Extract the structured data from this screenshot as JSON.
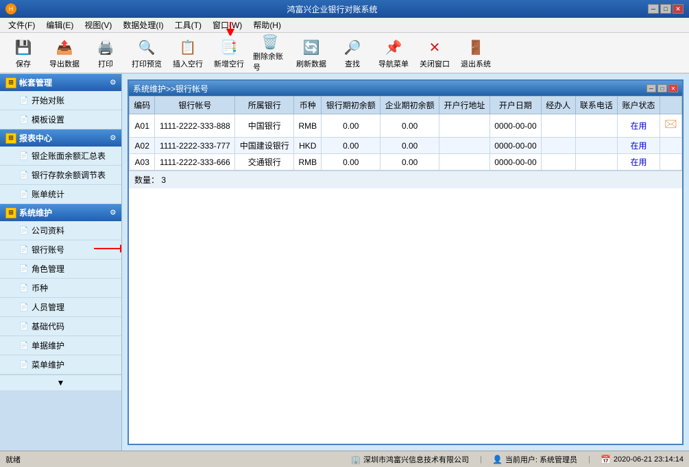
{
  "app": {
    "title": "鸿富兴企业银行对账系统",
    "status_text": "就绪",
    "company": "深圳市鸿富兴信息技术有限公司",
    "current_user": "当前用户: 系统管理员",
    "datetime": "2020-06-21 23:14:14"
  },
  "menu": {
    "items": [
      {
        "label": "文件(F)"
      },
      {
        "label": "编辑(E)"
      },
      {
        "label": "视图(V)"
      },
      {
        "label": "数据处理(I)"
      },
      {
        "label": "工具(T)"
      },
      {
        "label": "窗口(W)"
      },
      {
        "label": "帮助(H)"
      }
    ]
  },
  "toolbar": {
    "buttons": [
      {
        "id": "save",
        "label": "保存",
        "icon": "💾"
      },
      {
        "id": "export",
        "label": "导出数据",
        "icon": "📤"
      },
      {
        "id": "print",
        "label": "打印",
        "icon": "🖨️"
      },
      {
        "id": "print-preview",
        "label": "打印预览",
        "icon": "🔍"
      },
      {
        "id": "insert-blank",
        "label": "插入空行",
        "icon": "📋"
      },
      {
        "id": "add-blank",
        "label": "新增空行",
        "icon": "📑"
      },
      {
        "id": "delete-row",
        "label": "删除余账号",
        "icon": "🗑️"
      },
      {
        "id": "refresh",
        "label": "刷新数据",
        "icon": "🔄"
      },
      {
        "id": "find",
        "label": "查找",
        "icon": "🔎"
      },
      {
        "id": "nav-menu",
        "label": "导航菜单",
        "icon": "📌"
      },
      {
        "id": "close-window",
        "label": "关闭窗口",
        "icon": "❌"
      },
      {
        "id": "exit",
        "label": "退出系统",
        "icon": "🚪"
      }
    ]
  },
  "sidebar": {
    "sections": [
      {
        "id": "account-management",
        "title": "帐套管理",
        "icon": "⊞",
        "expanded": true,
        "items": [
          {
            "id": "start-account",
            "label": "开始对账",
            "icon": "📄"
          },
          {
            "id": "template-settings",
            "label": "模板设置",
            "icon": "📄"
          }
        ]
      },
      {
        "id": "report-center",
        "title": "报表中心",
        "icon": "⊞",
        "expanded": true,
        "items": [
          {
            "id": "bank-balance-summary",
            "label": "银企账面余额汇总表",
            "icon": "📄"
          },
          {
            "id": "bank-deposit-balance",
            "label": "银行存款余额调节表",
            "icon": "📄"
          },
          {
            "id": "bill-statistics",
            "label": "账单统计",
            "icon": "📄"
          }
        ]
      },
      {
        "id": "system-maintenance",
        "title": "系统维护",
        "icon": "⊞",
        "expanded": true,
        "items": [
          {
            "id": "company-info",
            "label": "公司资料",
            "icon": "📄"
          },
          {
            "id": "bank-account",
            "label": "银行账号",
            "icon": "📄"
          },
          {
            "id": "role-management",
            "label": "角色管理",
            "icon": "📄"
          },
          {
            "id": "currency",
            "label": "币种",
            "icon": "📄"
          },
          {
            "id": "personnel-management",
            "label": "人员管理",
            "icon": "📄"
          },
          {
            "id": "basic-code",
            "label": "基础代码",
            "icon": "📄"
          },
          {
            "id": "voucher-maintenance",
            "label": "单据维护",
            "icon": "📄"
          },
          {
            "id": "menu-maintenance",
            "label": "菜单维护",
            "icon": "📄"
          }
        ]
      }
    ]
  },
  "sub_window": {
    "title": "系统维护>>银行帐号",
    "table": {
      "headers": [
        "编码",
        "银行帐号",
        "所属银行",
        "币种",
        "银行期初余额",
        "企业期初余额",
        "开户行地址",
        "开户日期",
        "经办人",
        "联系电话",
        "账户状态"
      ],
      "rows": [
        {
          "code": "A01",
          "account": "1111-2222-333-888",
          "bank": "中国银行",
          "currency": "RMB",
          "bank_balance": "0.00",
          "enterprise_balance": "0.00",
          "address": "",
          "date": "0000-00-00",
          "agent": "",
          "phone": "",
          "status": "在用",
          "has_icon": true
        },
        {
          "code": "A02",
          "account": "1111-2222-333-777",
          "bank": "中国建设银行",
          "currency": "HKD",
          "bank_balance": "0.00",
          "enterprise_balance": "0.00",
          "address": "",
          "date": "0000-00-00",
          "agent": "",
          "phone": "",
          "status": "在用",
          "has_icon": false
        },
        {
          "code": "A03",
          "account": "1111-2222-333-666",
          "bank": "交通银行",
          "currency": "RMB",
          "bank_balance": "0.00",
          "enterprise_balance": "0.00",
          "address": "",
          "date": "0000-00-00",
          "agent": "",
          "phone": "",
          "status": "在用",
          "has_icon": false
        }
      ],
      "count_label": "数量：",
      "count": "3"
    }
  },
  "status_bar": {
    "ready_text": "就绪",
    "company_icon": "🏢",
    "company_text": "深圳市鸿富兴信息技术有限公司",
    "user_icon": "👤",
    "user_text": "当前用户: 系统管理员",
    "time_icon": "📅",
    "time_text": "2020-06-21 23:14:14"
  }
}
